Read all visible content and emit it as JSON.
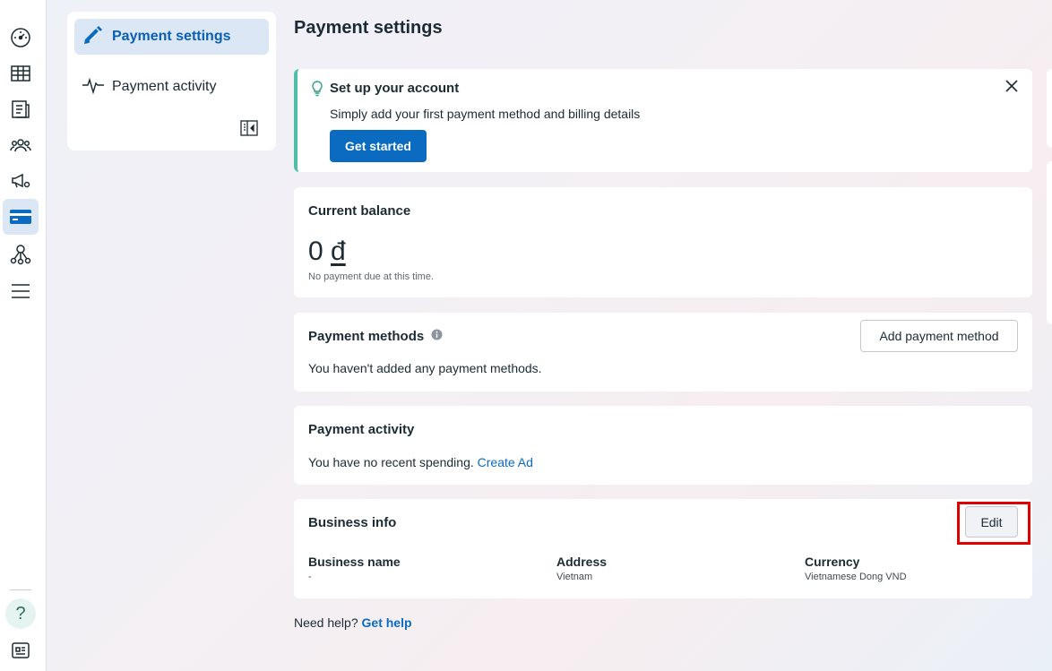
{
  "subnav": {
    "items": [
      {
        "label": "Payment settings",
        "icon": "pencil-icon"
      },
      {
        "label": "Payment activity",
        "icon": "pulse-icon"
      }
    ]
  },
  "page": {
    "title": "Payment settings"
  },
  "setup": {
    "title": "Set up your account",
    "description": "Simply add your first payment method and billing details",
    "cta": "Get started"
  },
  "balance": {
    "title": "Current balance",
    "amount": "0",
    "currency_symbol": "đ",
    "note": "No payment due at this time."
  },
  "methods": {
    "title": "Payment methods",
    "empty": "You haven't added any payment methods.",
    "add_label": "Add payment method"
  },
  "activity": {
    "title": "Payment activity",
    "empty": "You have no recent spending.",
    "link": "Create Ad"
  },
  "business": {
    "title": "Business info",
    "edit_label": "Edit",
    "fields": [
      {
        "label": "Business name",
        "value": "-"
      },
      {
        "label": "Address",
        "value": "Vietnam"
      },
      {
        "label": "Currency",
        "value": "Vietnamese Dong VND"
      }
    ]
  },
  "help": {
    "prefix": "Need help?",
    "link": "Get help"
  },
  "colors": {
    "accent": "#0a6bc1",
    "setup_border": "#4fbfa7",
    "highlight": "#e00000"
  }
}
